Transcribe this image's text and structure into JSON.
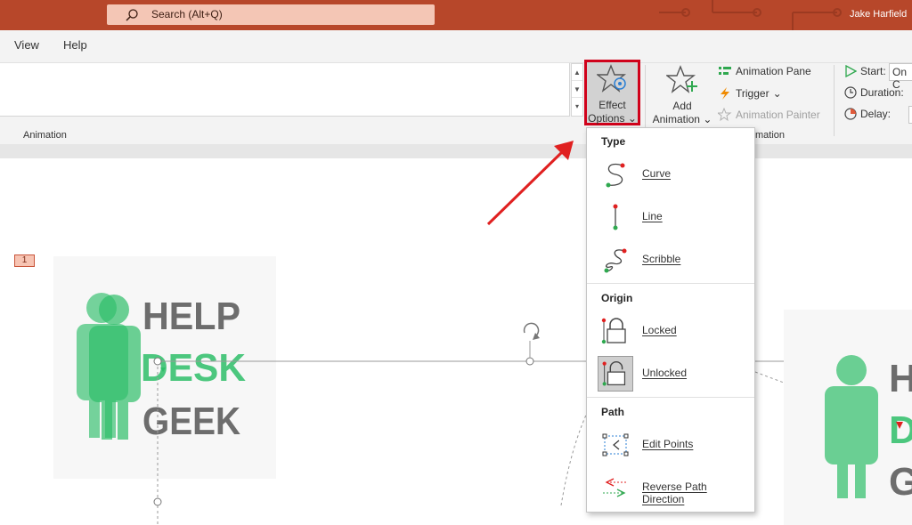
{
  "titlebar": {
    "search_placeholder": "Search (Alt+Q)",
    "user": "Jake Harfield"
  },
  "menubar": {
    "items": [
      "View",
      "Help"
    ]
  },
  "ribbon": {
    "animation_group_label": "Animation",
    "advanced_group_label_fragment": "mation",
    "effect_options": {
      "line1": "Effect",
      "line2": "Options"
    },
    "add_animation": {
      "line1": "Add",
      "line2": "Animation"
    },
    "animation_pane": "Animation Pane",
    "trigger": "Trigger",
    "animation_painter": "Animation Painter",
    "timing": {
      "start_label": "Start:",
      "start_value": "On C",
      "duration_label": "Duration:",
      "delay_label": "Delay:"
    }
  },
  "slide": {
    "number": "1",
    "logo_words": [
      "HELP",
      "DESK",
      "GEEK"
    ]
  },
  "effect_menu": {
    "sections": [
      {
        "header": "Type",
        "items": [
          {
            "label": "Curve",
            "icon": "curve-path-icon",
            "active": false
          },
          {
            "label": "Line",
            "icon": "line-path-icon",
            "active": false
          },
          {
            "label": "Scribble",
            "icon": "scribble-path-icon",
            "active": false
          }
        ]
      },
      {
        "header": "Origin",
        "items": [
          {
            "label": "Locked",
            "icon": "locked-icon",
            "active": false
          },
          {
            "label": "Unlocked",
            "icon": "unlocked-icon",
            "active": true
          }
        ]
      },
      {
        "header": "Path",
        "items": [
          {
            "label": "Edit Points",
            "icon": "edit-points-icon",
            "active": false
          },
          {
            "label": "Reverse Path Direction",
            "icon": "reverse-path-icon",
            "active": false
          }
        ]
      }
    ]
  },
  "colors": {
    "titlebar": "#b7472a",
    "highlight_box": "#d0021b",
    "arrow": "#e02020",
    "logo_green": "#2fbf6a",
    "logo_gray": "#5a5a5a"
  }
}
